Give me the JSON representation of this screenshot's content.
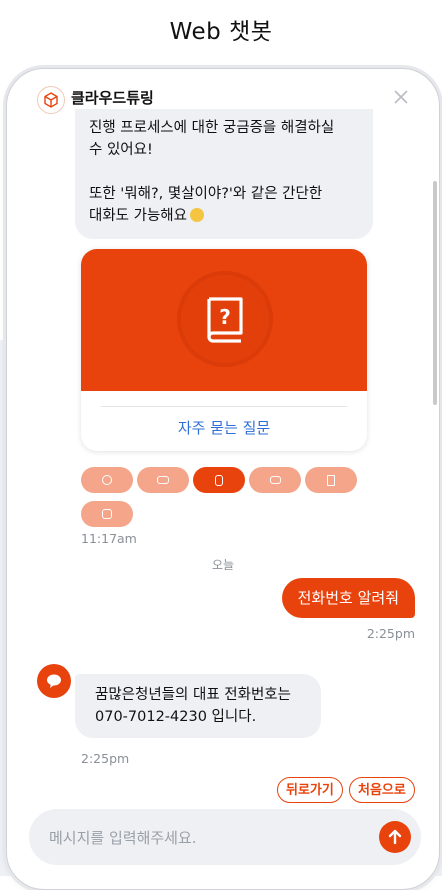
{
  "page": {
    "title": "Web 챗봇"
  },
  "colors": {
    "accent": "#e8430d",
    "accent_light": "#f4a58a",
    "link": "#2f6fd6",
    "bubble_bg": "#eef0f4"
  },
  "header": {
    "brand_name": "클라우드튜링",
    "logo_icon": "cube-logo-icon",
    "close_icon": "close-icon"
  },
  "messages": {
    "intro_line1": "진행 프로세스에 대한 궁금증을 해결하실",
    "intro_line2": "수 있어요!",
    "intro_line3": "또한 '뭐해?, 몇살이야?'와 같은  간단한",
    "intro_line4": "대화도 가능해요",
    "card_link": "자주 묻는 질문",
    "card_icon": "book-question-icon",
    "time_1": "11:17am",
    "date_separator": "오늘",
    "user_message": "전화번호 알려줘",
    "time_user": "2:25pm",
    "bot_line1": "꿈많은청년들의 대표 전화번호는",
    "bot_line2": "070-7012-4230 입니다.",
    "time_bot": "2:25pm"
  },
  "chips": [
    {
      "icon": "chat-icon",
      "active": false
    },
    {
      "icon": "card-icon",
      "active": false
    },
    {
      "icon": "book-icon",
      "active": true
    },
    {
      "icon": "list-icon",
      "active": false
    },
    {
      "icon": "building-icon",
      "active": false
    },
    {
      "icon": "comment-icon",
      "active": false
    }
  ],
  "quick_replies": {
    "back": "뒤로가기",
    "home": "처음으로"
  },
  "composer": {
    "placeholder": "메시지를 입력해주세요.",
    "send_icon": "arrow-up-icon"
  }
}
